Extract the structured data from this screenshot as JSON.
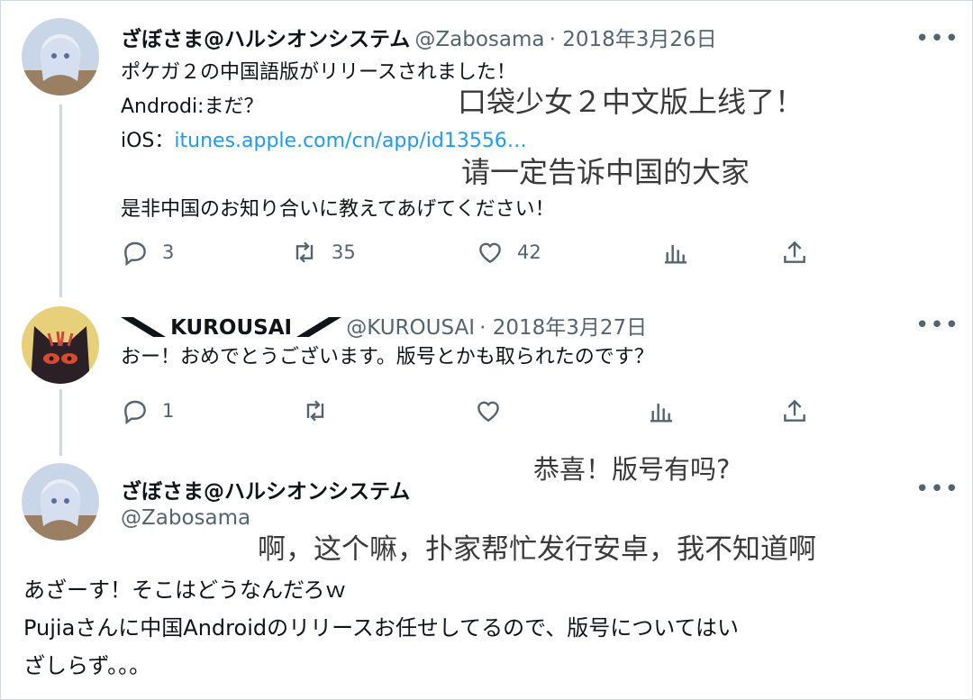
{
  "tweets": [
    {
      "author": "ざぼさま@ハルシオンシステム",
      "handle": "@Zabosama",
      "date": "2018年3月26日",
      "lines": [
        "ポケガ２の中国語版がリリースされました！",
        "Androdi:まだ？",
        "iOS："
      ],
      "link": "itunes.apple.com/cn/app/id13556…",
      "last_line": "是非中国のお知り合いに教えてあげてください！",
      "reply_count": "3",
      "retweet_count": "35",
      "like_count": "42"
    },
    {
      "author": "KUROUSAI",
      "handle": "@KUROUSAI",
      "date": "2018年3月27日",
      "text": "おー！おめでとうございます。版号とかも取られたのです？",
      "reply_count": "1"
    },
    {
      "author": "ざぼさま@ハルシオンシステム",
      "handle": "@Zabosama",
      "lines": [
        "あざーす！そこはどうなんだろｗ",
        "Pujiaさんに中国Androidのリリースお任せしてるので、版号についてはい",
        "ざしらず。。。"
      ]
    }
  ],
  "annotations": [
    "口袋少女２中文版上线了！",
    "请一定告诉中国的大家",
    "恭喜！版号有吗?",
    "啊，这个嘛，扑家帮忙发行安卓，我不知道啊"
  ],
  "icons": {
    "more": "more-icon",
    "reply": "reply-icon",
    "retweet": "retweet-icon",
    "like": "like-icon",
    "analytics": "analytics-icon",
    "share": "share-icon"
  }
}
